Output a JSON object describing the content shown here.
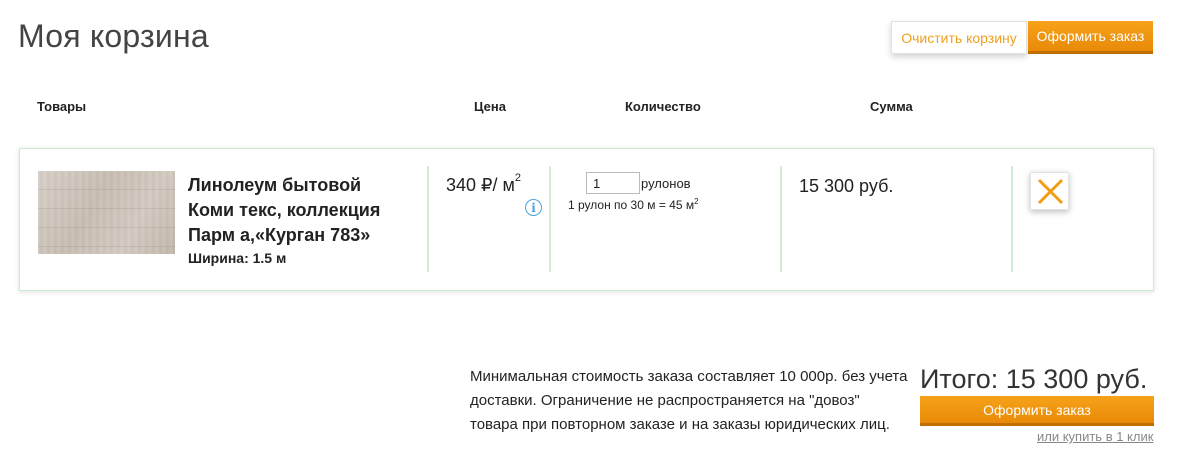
{
  "page": {
    "title": "Моя корзина"
  },
  "actions": {
    "clear_label": "Очистить корзину",
    "order_label": "Оформить заказ"
  },
  "table": {
    "headers": {
      "goods": "Товары",
      "price": "Цена",
      "quantity": "Количество",
      "sum": "Сумма"
    }
  },
  "item": {
    "name": "Линолеум бытовой Коми текс, коллекция Парм а,«Курган 783»",
    "width": "Ширина: 1.5 м",
    "price": "340 ₽/ м",
    "price_unit_exp": "2",
    "info_icon": "info-icon",
    "quantity_value": "1",
    "quantity_unit": "рулонов",
    "roll_note": "1 рулон по 30 м = 45 м",
    "roll_note_exp": "2",
    "sum": "15 300 руб.",
    "remove_icon": "close-icon"
  },
  "summary": {
    "min_order_note": "Минимальная стоимость заказа составляет 10 000р. без учета доставки. Ограничение не распространяется на \"довоз\" товара при повторном заказе и на заказы юридических лиц.",
    "total": "Итого: 15 300 руб.",
    "order_label": "Оформить заказ",
    "one_click_label": "или купить в 1 клик"
  },
  "colors": {
    "accent": "#f39c12",
    "row_border": "#c8ecd0",
    "info": "#4aa3df",
    "remove": "#f39c12"
  }
}
